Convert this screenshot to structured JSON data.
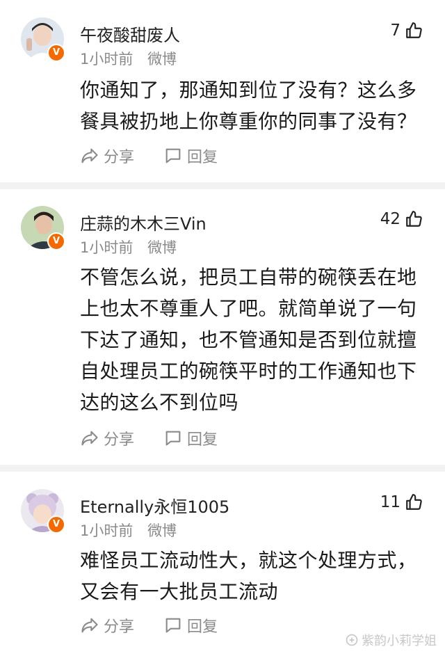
{
  "comments": [
    {
      "username": "午夜酸甜废人",
      "time": "1小时前",
      "source": "微博",
      "likes": "7",
      "lines": [
        "你通知了，那通知到位了没有？这么多",
        "餐具被扔地上你尊重你的同事了没有？"
      ],
      "share_label": "分享",
      "reply_label": "回复",
      "badge": "V"
    },
    {
      "username": "庄蒜的木木三Vin",
      "time": "1小时前",
      "source": "微博",
      "likes": "42",
      "lines": [
        "不管怎么说，把员工自带的碗筷丢在地",
        "上也太不尊重人了吧。就简单说了一句",
        "下达了通知，也不管通知是否到位就擅",
        "自处理员工的碗筷平时的工作通知也下",
        "达的这么不到位吗"
      ],
      "share_label": "分享",
      "reply_label": "回复",
      "badge": "V"
    },
    {
      "username": "Eternally永恒1005",
      "time": "1小时前",
      "source": "微博",
      "likes": "11",
      "lines": [
        "难怪员工流动性大，就这个处理方式，",
        "又会有一大批员工流动"
      ],
      "share_label": "分享",
      "reply_label": "回复",
      "badge": "V"
    }
  ],
  "watermark": "紫韵小莉学姐",
  "colors": {
    "badge": "#f56a00",
    "meta": "#8a8a8a",
    "divider": "#f2f2f2"
  }
}
